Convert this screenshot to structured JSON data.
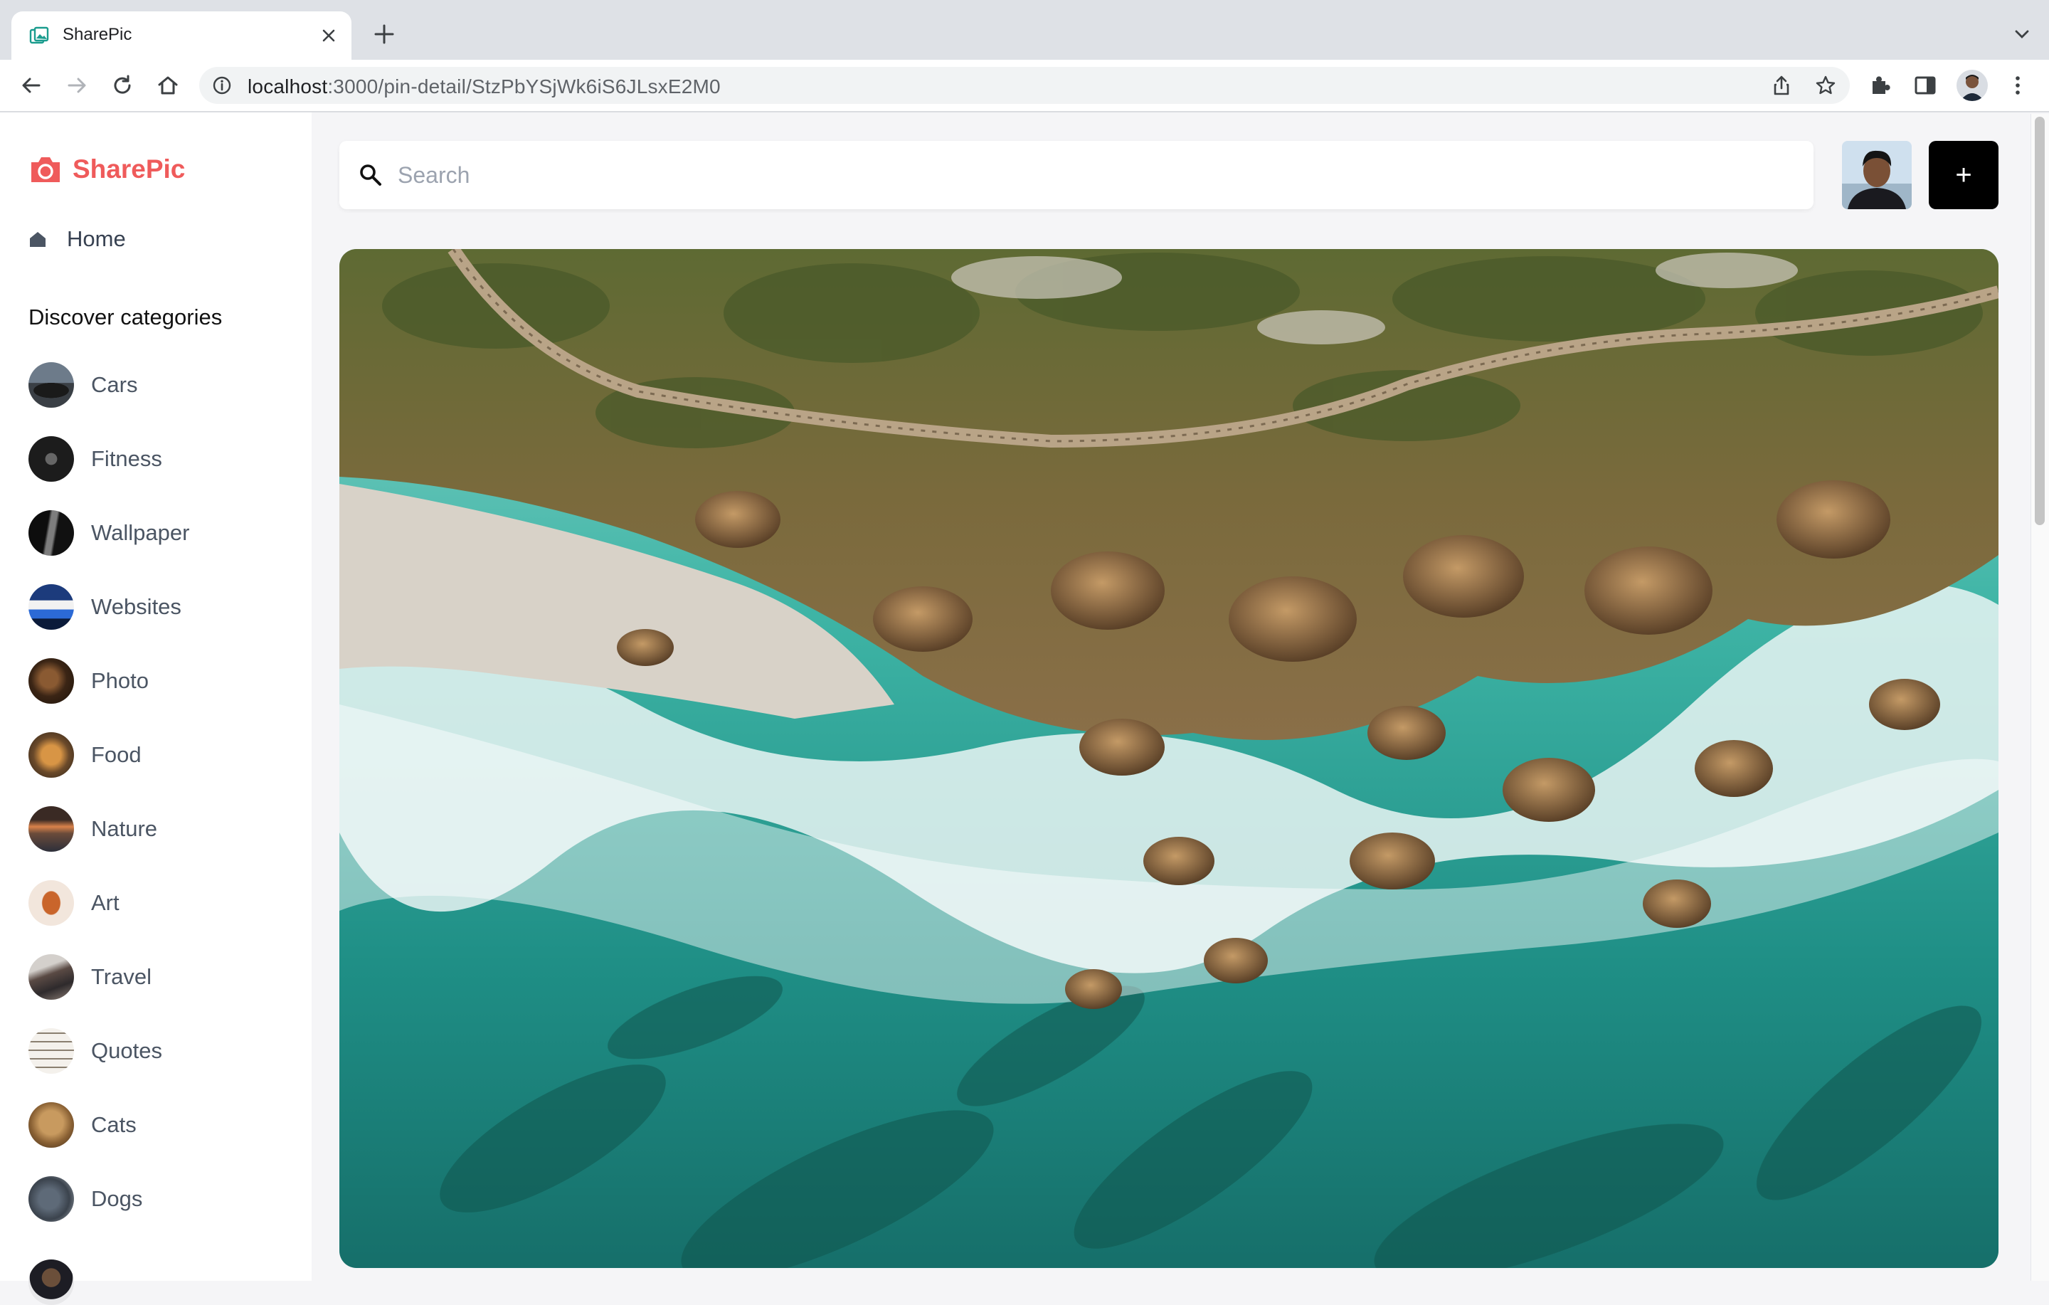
{
  "browser": {
    "tab_title": "SharePic",
    "url_host": "localhost",
    "url_path": ":3000/pin-detail/StzPbYSjWk6iS6JLsxE2M0"
  },
  "sidebar": {
    "brand": "SharePic",
    "home_label": "Home",
    "discover_title": "Discover categories",
    "categories": [
      {
        "label": "Cars"
      },
      {
        "label": "Fitness"
      },
      {
        "label": "Wallpaper"
      },
      {
        "label": "Websites"
      },
      {
        "label": "Photo"
      },
      {
        "label": "Food"
      },
      {
        "label": "Nature"
      },
      {
        "label": "Art"
      },
      {
        "label": "Travel"
      },
      {
        "label": "Quotes"
      },
      {
        "label": "Cats"
      },
      {
        "label": "Dogs"
      }
    ]
  },
  "search": {
    "placeholder": "Search",
    "value": ""
  },
  "header": {
    "add_label": "+"
  },
  "colors": {
    "brand": "#ef5b5b",
    "add_button": "#000000"
  }
}
